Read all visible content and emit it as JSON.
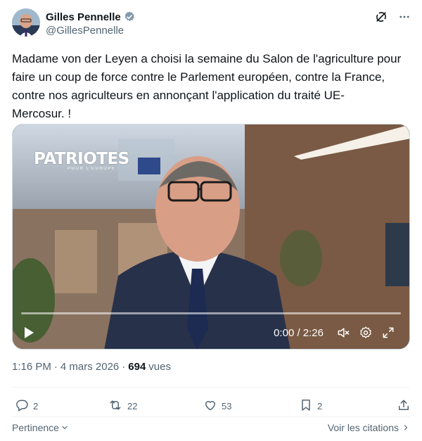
{
  "author": {
    "name": "Gilles Pennelle",
    "handle": "@GillesPennelle",
    "verified_color": "#829aab"
  },
  "tweet": {
    "text": "Madame von der Leyen a choisi la semaine du Salon de l'agriculture pour faire un coup de force contre le Parlement européen, contre la France, contre nos agriculteurs en annonçant l'application du traité UE-\nMercosur. !"
  },
  "video": {
    "brand_title": "PATRIOTES",
    "brand_subtitle": "POUR L'EUROPE",
    "time": "0:00 / 2:26",
    "progress_fraction": 0.0,
    "accent": "#1d9bf0"
  },
  "meta": {
    "time": "1:16 PM",
    "dot": "·",
    "date": "4 mars 2026",
    "views_count": "694",
    "views_label": "vues"
  },
  "actions": {
    "replies": "2",
    "reposts": "22",
    "likes": "53",
    "bookmarks": "2"
  },
  "footer": {
    "relevance": "Pertinence",
    "quotes": "Voir les citations"
  },
  "icons": [
    "verified-badge-icon",
    "grok-icon",
    "more-icon",
    "play-icon",
    "volume-icon",
    "settings-icon",
    "fullscreen-icon",
    "reply-icon",
    "repost-icon",
    "like-icon",
    "bookmark-icon",
    "share-icon",
    "chevron-down-icon",
    "chevron-right-icon"
  ]
}
